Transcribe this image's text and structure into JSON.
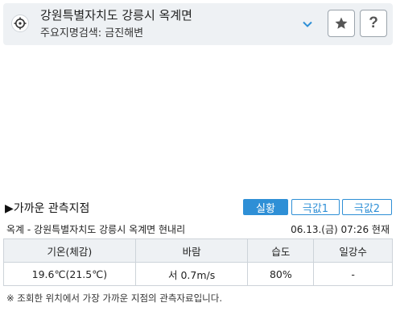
{
  "location": {
    "title": "강원특별자치도 강릉시 옥계면",
    "subtitle": "주요지명검색: 금진해변"
  },
  "icons": {
    "target": "crosshair-target-icon",
    "dropdown": "chevron-down-icon",
    "favorite": "star-icon",
    "help": "question-mark-icon"
  },
  "help_label": "?",
  "colors": {
    "accent": "#2e8fd6",
    "header_bg": "#eef1f4"
  },
  "section": {
    "title": "▶가까운 관측지점"
  },
  "tabs": [
    {
      "label": "실황",
      "active": true
    },
    {
      "label": "극값1",
      "active": false
    },
    {
      "label": "극값2",
      "active": false
    }
  ],
  "station": {
    "name": "옥계 - 강원특별자치도 강릉시 옥계면 현내리",
    "time": "06.13.(금) 07:26 현재"
  },
  "table": {
    "headers": [
      "기온(체감)",
      "바람",
      "습도",
      "일강수"
    ],
    "row": [
      "19.6℃(21.5℃)",
      "서 0.7m/s",
      "80%",
      "-"
    ]
  },
  "note": "※ 조회한 위치에서 가장 가까운 지점의 관측자료입니다."
}
